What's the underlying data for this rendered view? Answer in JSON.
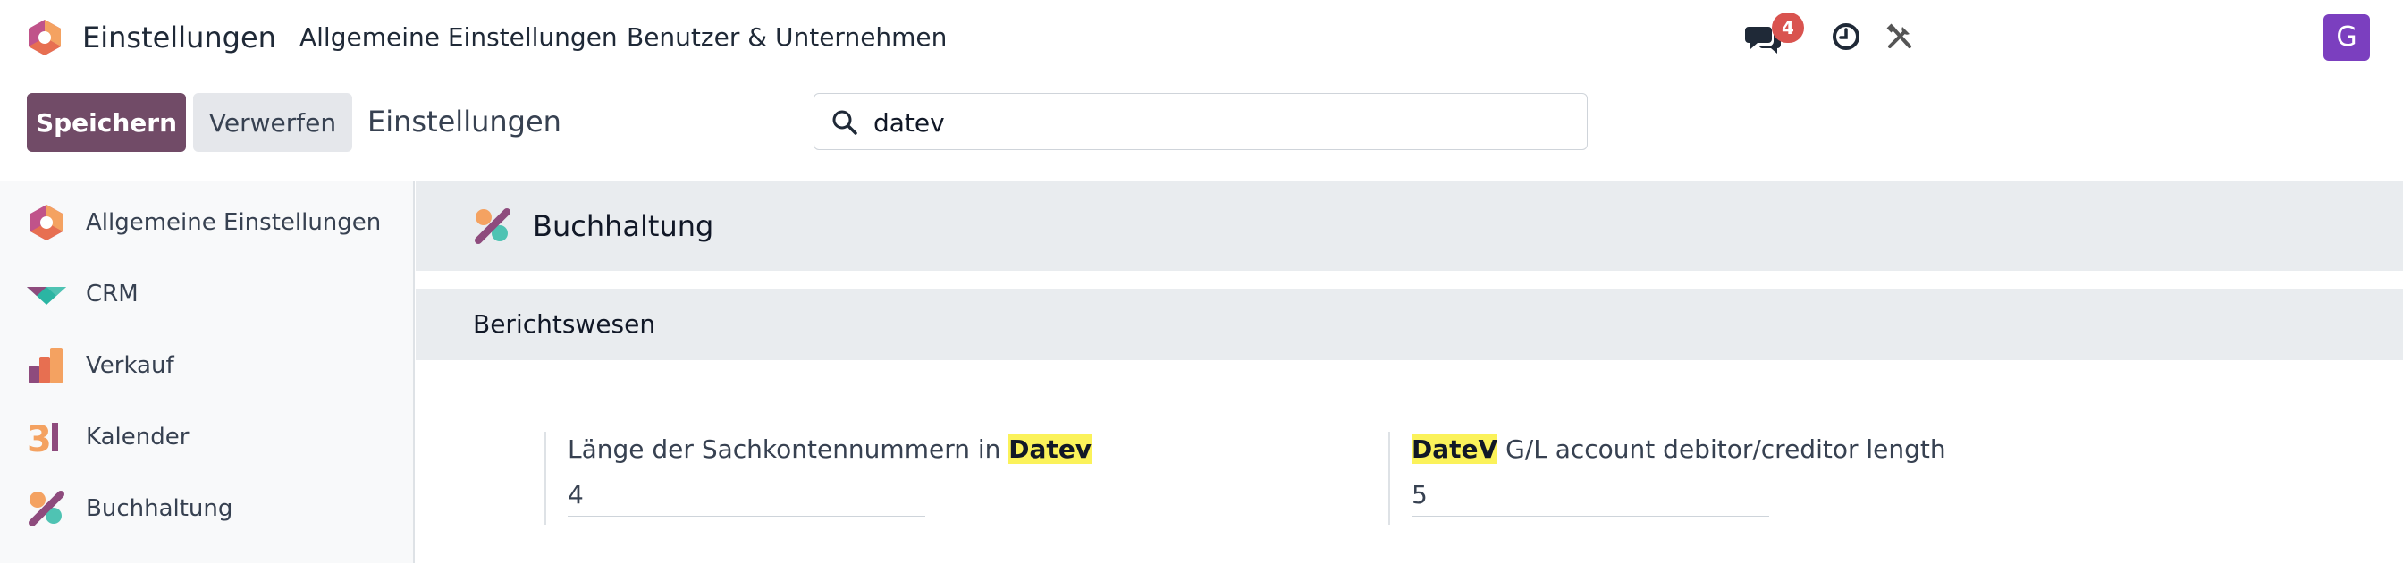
{
  "navbar": {
    "app_title": "Einstellungen",
    "menu": [
      "Allgemeine Einstellungen",
      "Benutzer & Unternehmen"
    ],
    "chat_count": "4",
    "avatar_initial": "G",
    "icons": [
      "settings-app-logo",
      "chat-icon",
      "clock-icon",
      "tools-icon"
    ]
  },
  "control_panel": {
    "save_label": "Speichern",
    "discard_label": "Verwerfen",
    "breadcrumb": "Einstellungen",
    "search_value": "datev"
  },
  "sidebar": {
    "items": [
      {
        "label": "Allgemeine Einstellungen",
        "icon": "settings-app-icon"
      },
      {
        "label": "CRM",
        "icon": "crm-app-icon"
      },
      {
        "label": "Verkauf",
        "icon": "sales-app-icon"
      },
      {
        "label": "Kalender",
        "icon": "calendar-app-icon"
      },
      {
        "label": "Buchhaltung",
        "icon": "accounting-app-icon"
      }
    ]
  },
  "main": {
    "app_section_title": "Buchhaltung",
    "block_title": "Berichtswesen",
    "settings": [
      {
        "label_before": "Länge der Sachkontennummern in ",
        "label_highlight": "Datev",
        "label_after": "",
        "value": "4"
      },
      {
        "label_before": "",
        "label_highlight": "DateV",
        "label_after": " G/L account debitor/creditor length",
        "value": "5"
      }
    ]
  },
  "colors": {
    "primary": "#714b67",
    "badge": "#d9534f",
    "avatar": "#7b3fbf",
    "highlight": "#fbf25a",
    "section_bg": "#e9ecef"
  }
}
